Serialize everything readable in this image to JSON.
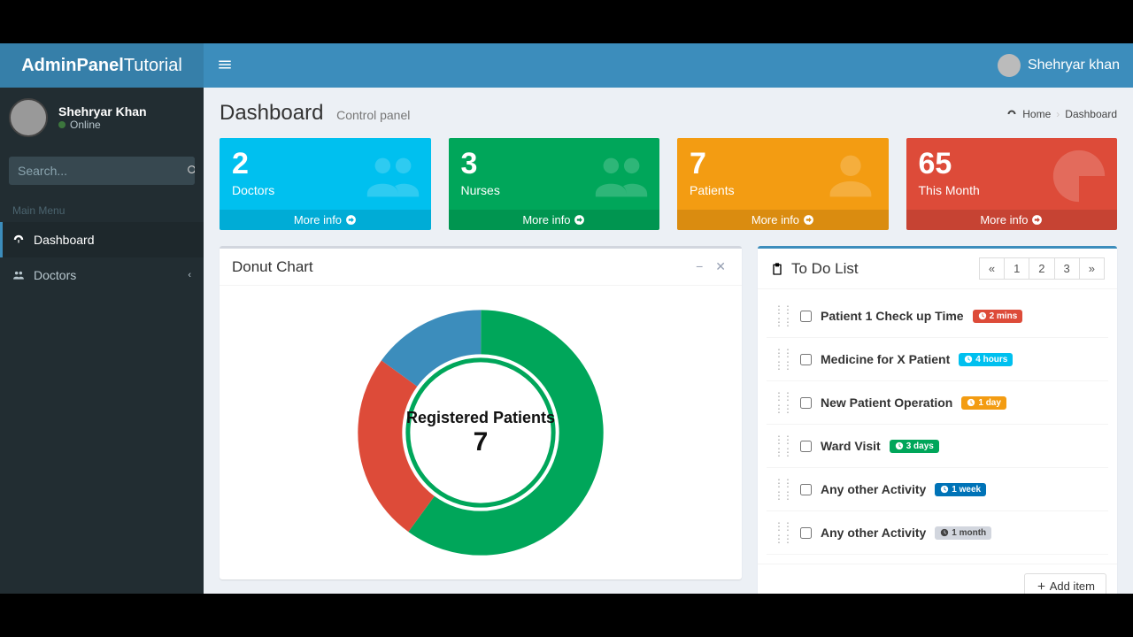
{
  "brand": {
    "bold": "AdminPanel",
    "light": "Tutorial"
  },
  "nav_user": "Shehryar khan",
  "sidebar": {
    "user_name": "Shehryar Khan",
    "user_status": "Online",
    "search_placeholder": "Search...",
    "menu_header": "Main Menu",
    "items": [
      {
        "label": "Dashboard",
        "icon": "dashboard-icon",
        "active": true
      },
      {
        "label": "Doctors",
        "icon": "users-icon",
        "active": false,
        "expandable": true
      }
    ]
  },
  "page": {
    "title": "Dashboard",
    "subtitle": "Control panel",
    "breadcrumb_home": "Home",
    "breadcrumb_current": "Dashboard"
  },
  "cards": [
    {
      "value": "2",
      "label": "Doctors",
      "link": "More info",
      "color": "#00c0ef"
    },
    {
      "value": "3",
      "label": "Nurses",
      "link": "More info",
      "color": "#00a65a"
    },
    {
      "value": "7",
      "label": "Patients",
      "link": "More info",
      "color": "#f39c12"
    },
    {
      "value": "65",
      "label": "This Month",
      "link": "More info",
      "color": "#dd4b39"
    }
  ],
  "donut": {
    "title": "Donut Chart"
  },
  "chart_data": {
    "type": "pie",
    "title": "Registered Patients",
    "center_value": 7,
    "series": [
      {
        "name": "Green slice",
        "value": 60,
        "color": "#00a65a"
      },
      {
        "name": "Red slice",
        "value": 25,
        "color": "#dd4b39"
      },
      {
        "name": "Blue slice",
        "value": 15,
        "color": "#3c8dbc"
      }
    ]
  },
  "todo": {
    "title": "To Do List",
    "pager": [
      "«",
      "1",
      "2",
      "3",
      "»"
    ],
    "items": [
      {
        "text": "Patient 1 Check up Time",
        "badge": "2 mins",
        "badge_class": "b-red"
      },
      {
        "text": "Medicine for X Patient",
        "badge": "4 hours",
        "badge_class": "b-aqua"
      },
      {
        "text": "New Patient Operation",
        "badge": "1 day",
        "badge_class": "b-yellow"
      },
      {
        "text": "Ward Visit",
        "badge": "3 days",
        "badge_class": "b-green"
      },
      {
        "text": "Any other Activity",
        "badge": "1 week",
        "badge_class": "b-blue"
      },
      {
        "text": "Any other Activity",
        "badge": "1 month",
        "badge_class": "b-gray"
      }
    ],
    "add_label": "Add item"
  }
}
